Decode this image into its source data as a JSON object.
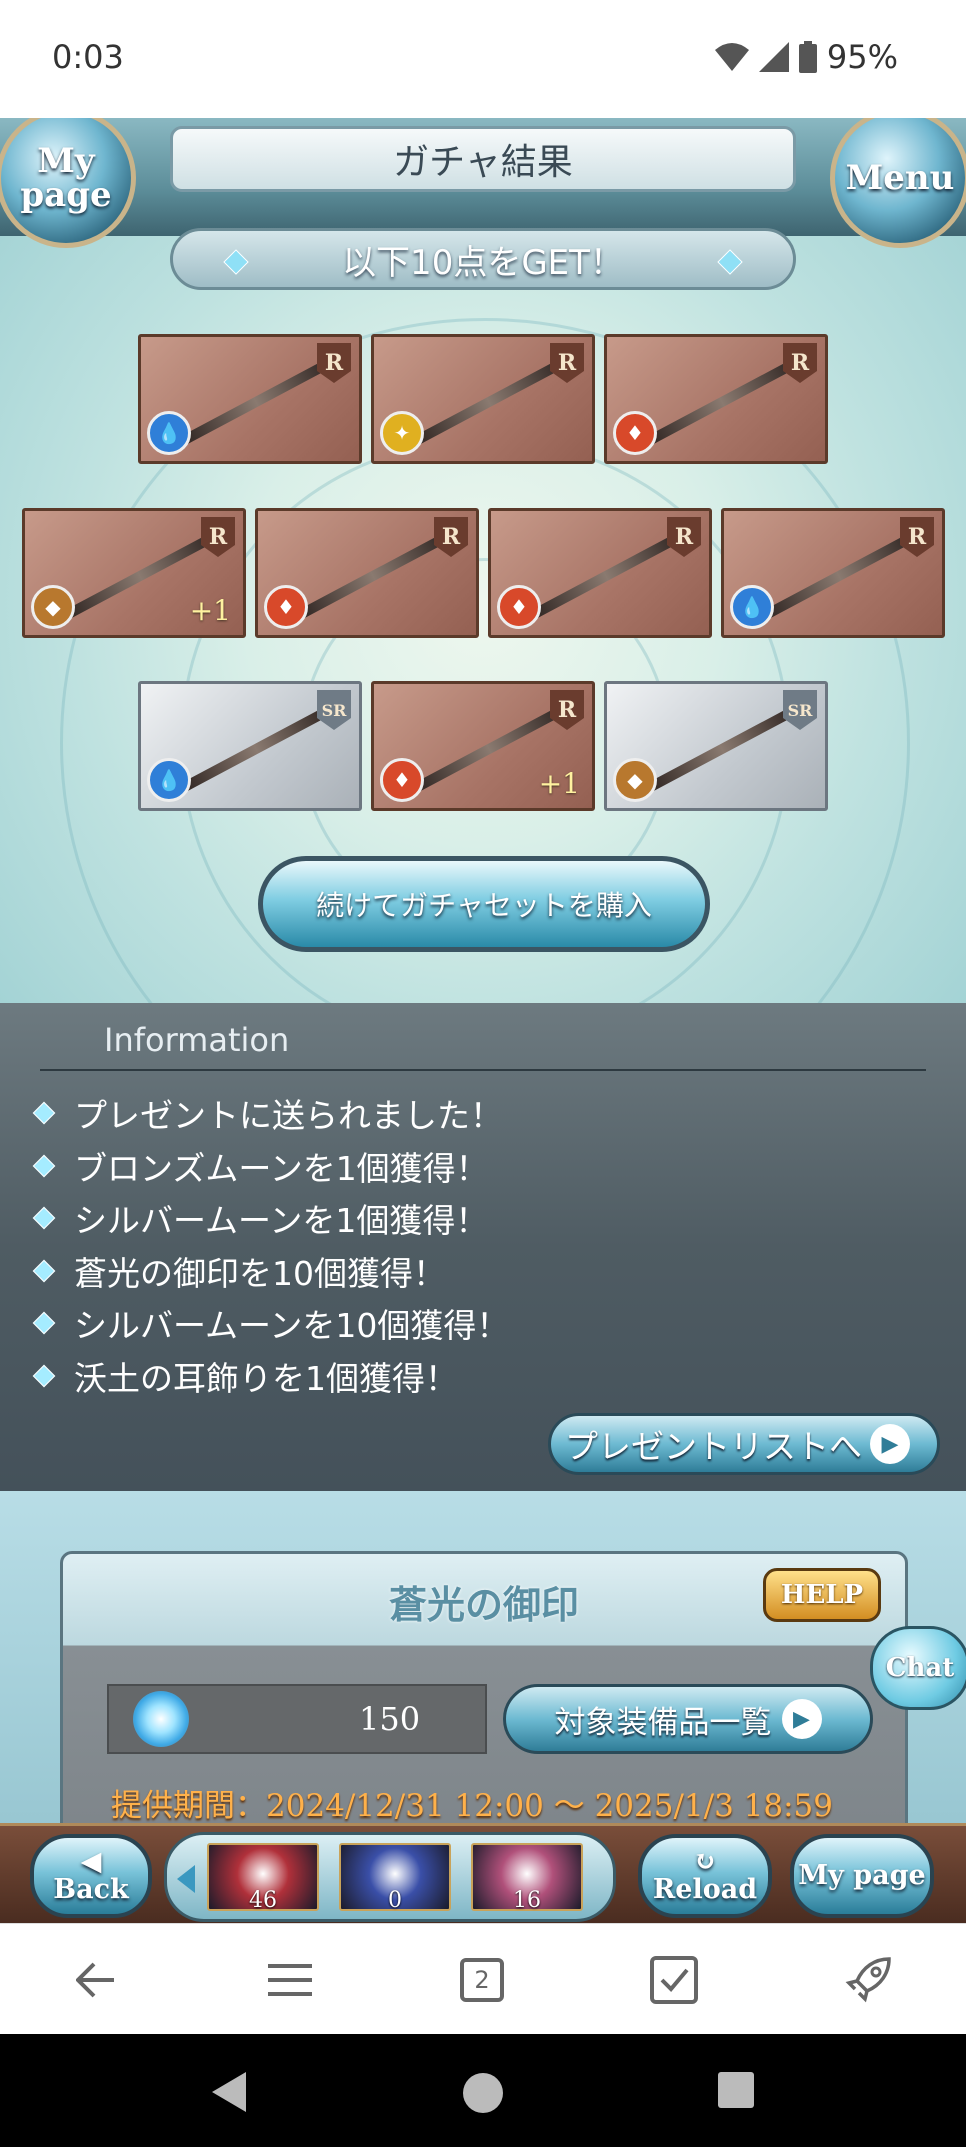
{
  "status_bar": {
    "time": "0:03",
    "battery": "95%"
  },
  "header": {
    "title": "ガチャ結果",
    "mypage_label": "My page",
    "menu_label": "Menu"
  },
  "result": {
    "banner": "以下10点をGET！",
    "rows": [
      [
        {
          "rarity": "R",
          "element": "water",
          "plus": ""
        },
        {
          "rarity": "R",
          "element": "light",
          "plus": ""
        },
        {
          "rarity": "R",
          "element": "fire",
          "plus": ""
        }
      ],
      [
        {
          "rarity": "R",
          "element": "earth",
          "plus": "+1"
        },
        {
          "rarity": "R",
          "element": "fire",
          "plus": ""
        },
        {
          "rarity": "R",
          "element": "fire",
          "plus": ""
        },
        {
          "rarity": "R",
          "element": "water",
          "plus": ""
        }
      ],
      [
        {
          "rarity": "SR",
          "element": "water",
          "plus": ""
        },
        {
          "rarity": "R",
          "element": "fire",
          "plus": "+1"
        },
        {
          "rarity": "SR",
          "element": "earth",
          "plus": ""
        }
      ]
    ],
    "buy_button": "続けてガチャセットを購入"
  },
  "element_colors": {
    "water": "#2f7fd8",
    "light": "#e0b020",
    "fire": "#d8492a",
    "earth": "#b8782e"
  },
  "information": {
    "title": "Information",
    "items": [
      "プレゼントに送られました！",
      "ブロンズムーンを1個獲得！",
      "シルバームーンを1個獲得！",
      "蒼光の御印を10個獲得！",
      "シルバームーンを10個獲得！",
      "沃土の耳飾りを1個獲得！"
    ],
    "present_button": "プレゼントリストへ"
  },
  "seal": {
    "title": "蒼光の御印",
    "help": "HELP",
    "count": "150",
    "equipment_button": "対象装備品一覧",
    "period": "提供期間：2024/12/31 12:00 ～ 2025/1/3 18:59"
  },
  "chat": "Chat",
  "game_bar": {
    "back": "Back",
    "reload": "Reload",
    "mypage": "My page",
    "items": [
      {
        "count": "46",
        "color": "#b0303a"
      },
      {
        "count": "0",
        "color": "#3a4fa8"
      },
      {
        "count": "16",
        "color": "#b0507a"
      }
    ]
  },
  "browser_nav": {
    "tab_count": "2"
  }
}
